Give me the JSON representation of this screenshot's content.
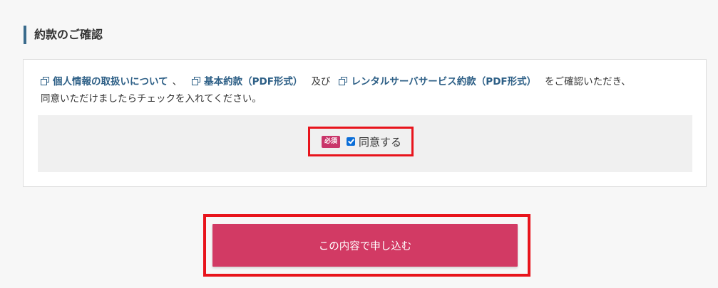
{
  "section": {
    "title": "約款のご確認"
  },
  "terms": {
    "link_privacy": "個人情報の取扱いについて",
    "separator": "、",
    "link_basic_terms": "基本約款（PDF形式）",
    "conjunction": "及び",
    "link_rental_terms": "レンタルサーバサービス約款（PDF形式）",
    "trailing_text": "をご確認いただき、",
    "second_line": "同意いただけましたらチェックを入れてください。"
  },
  "agreement": {
    "required_badge": "必須",
    "checkbox_checked": true,
    "label": "同意する"
  },
  "submit": {
    "label": "この内容で申し込む"
  },
  "colors": {
    "accent_title_bar": "#3a6b8c",
    "link": "#2d5f86",
    "required_badge": "#c9356a",
    "submit_button": "#d23a64",
    "highlight_outline": "#e8141c",
    "checkbox": "#0b6ed8"
  }
}
